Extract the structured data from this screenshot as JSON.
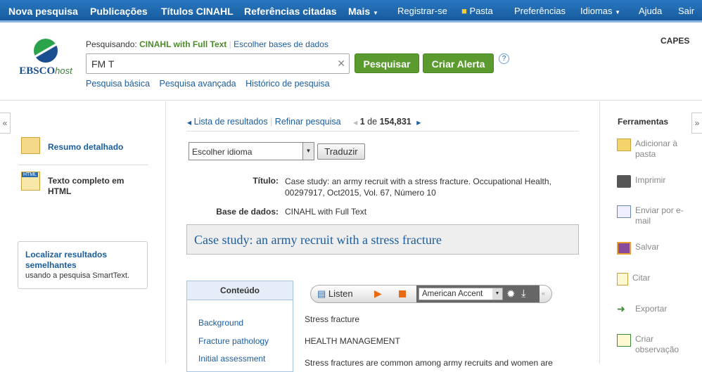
{
  "nav": {
    "items": [
      "Nova pesquisa",
      "Publicações",
      "Títulos CINAHL",
      "Referências citadas",
      "Mais"
    ],
    "right": [
      "Registrar-se",
      "Pasta",
      "Preferências",
      "Idiomas",
      "Ajuda",
      "Sair"
    ]
  },
  "header": {
    "logo": "EBSCOhost",
    "searching_label": "Pesquisando:",
    "database": "CINAHL with Full Text",
    "choose_db": "Escolher bases de dados",
    "query": "FM T",
    "search_btn": "Pesquisar",
    "alert_btn": "Criar Alerta",
    "help": "?",
    "links": [
      "Pesquisa básica",
      "Pesquisa avançada",
      "Histórico de pesquisa"
    ],
    "institution": "CAPES"
  },
  "left": {
    "items": [
      "Resumo detalhado",
      "Texto completo em HTML"
    ],
    "similar_title": "Localizar resultados semelhantes",
    "similar_sub": "usando a pesquisa SmartText.",
    "collapse": "«"
  },
  "main": {
    "results_link": "Lista de resultados",
    "refine_link": "Refinar pesquisa",
    "position": "1",
    "of": "de",
    "total": "154,831",
    "language_select": "Escolher idioma",
    "translate_btn": "Traduzir",
    "title_label": "Título:",
    "title_value": "Case study: an army recruit with a stress fracture. Occupational Health, 00297917, Oct2015, Vol. 67, Número 10",
    "db_label": "Base de dados:",
    "db_value": "CINAHL with Full Text",
    "article_title": "Case study: an army recruit with a stress fracture",
    "contents_title": "Conteúdo",
    "contents": [
      "Background",
      "Fracture pathology",
      "Initial assessment"
    ],
    "listen": "Listen",
    "accent": "American Accent",
    "body": [
      "Stress fracture",
      "HEALTH MANAGEMENT",
      "Stress fractures are common among army recruits and women are"
    ]
  },
  "right": {
    "title": "Ferramentas",
    "expand": "»",
    "tools": [
      "Adicionar à pasta",
      "Imprimir",
      "Enviar por e-mail",
      "Salvar",
      "Citar",
      "Exportar",
      "Criar observação"
    ]
  }
}
